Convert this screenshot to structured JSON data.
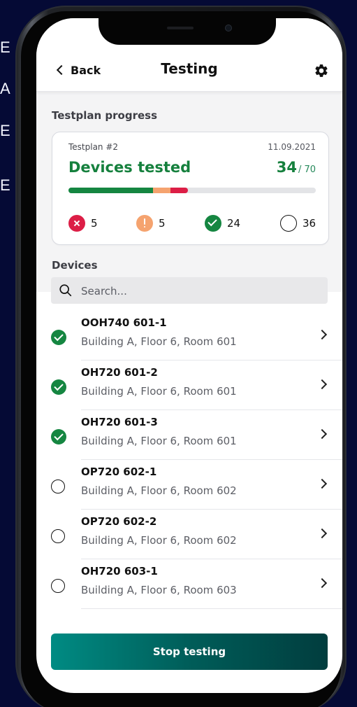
{
  "side_text": [
    "E",
    "A",
    "E",
    "E"
  ],
  "header": {
    "back_label": "Back",
    "title": "Testing"
  },
  "testplan": {
    "section_label": "Testplan progress",
    "name": "Testplan #2",
    "date": "11.09.2021",
    "headline": "Devices tested",
    "tested": "34",
    "total": "/ 70",
    "progress": {
      "green": 24,
      "orange": 5,
      "red": 5,
      "total": 70
    },
    "stats": {
      "failed": "5",
      "warning": "5",
      "passed": "24",
      "untested": "36"
    }
  },
  "devices": {
    "section_label": "Devices",
    "search_placeholder": "Search...",
    "items": [
      {
        "name": "OOH740 601-1",
        "location": "Building A, Floor 6, Room 601",
        "status": "passed"
      },
      {
        "name": "OH720 601-2",
        "location": "Building A, Floor 6, Room 601",
        "status": "passed"
      },
      {
        "name": "OH720 601-3",
        "location": "Building A, Floor 6, Room 601",
        "status": "passed"
      },
      {
        "name": "OP720 602-1",
        "location": "Building A, Floor 6, Room 602",
        "status": "untested"
      },
      {
        "name": "OP720 602-2",
        "location": "Building A, Floor 6, Room 602",
        "status": "untested"
      },
      {
        "name": "OH720 603-1",
        "location": "Building A, Floor 6, Room 603",
        "status": "untested"
      }
    ]
  },
  "actions": {
    "stop_label": "Stop testing"
  },
  "colors": {
    "accent_green": "#15803d",
    "passed": "#158641",
    "failed": "#dc1e46",
    "warning": "#f5a36f",
    "button_start": "#008b83",
    "button_end": "#013d3e"
  }
}
